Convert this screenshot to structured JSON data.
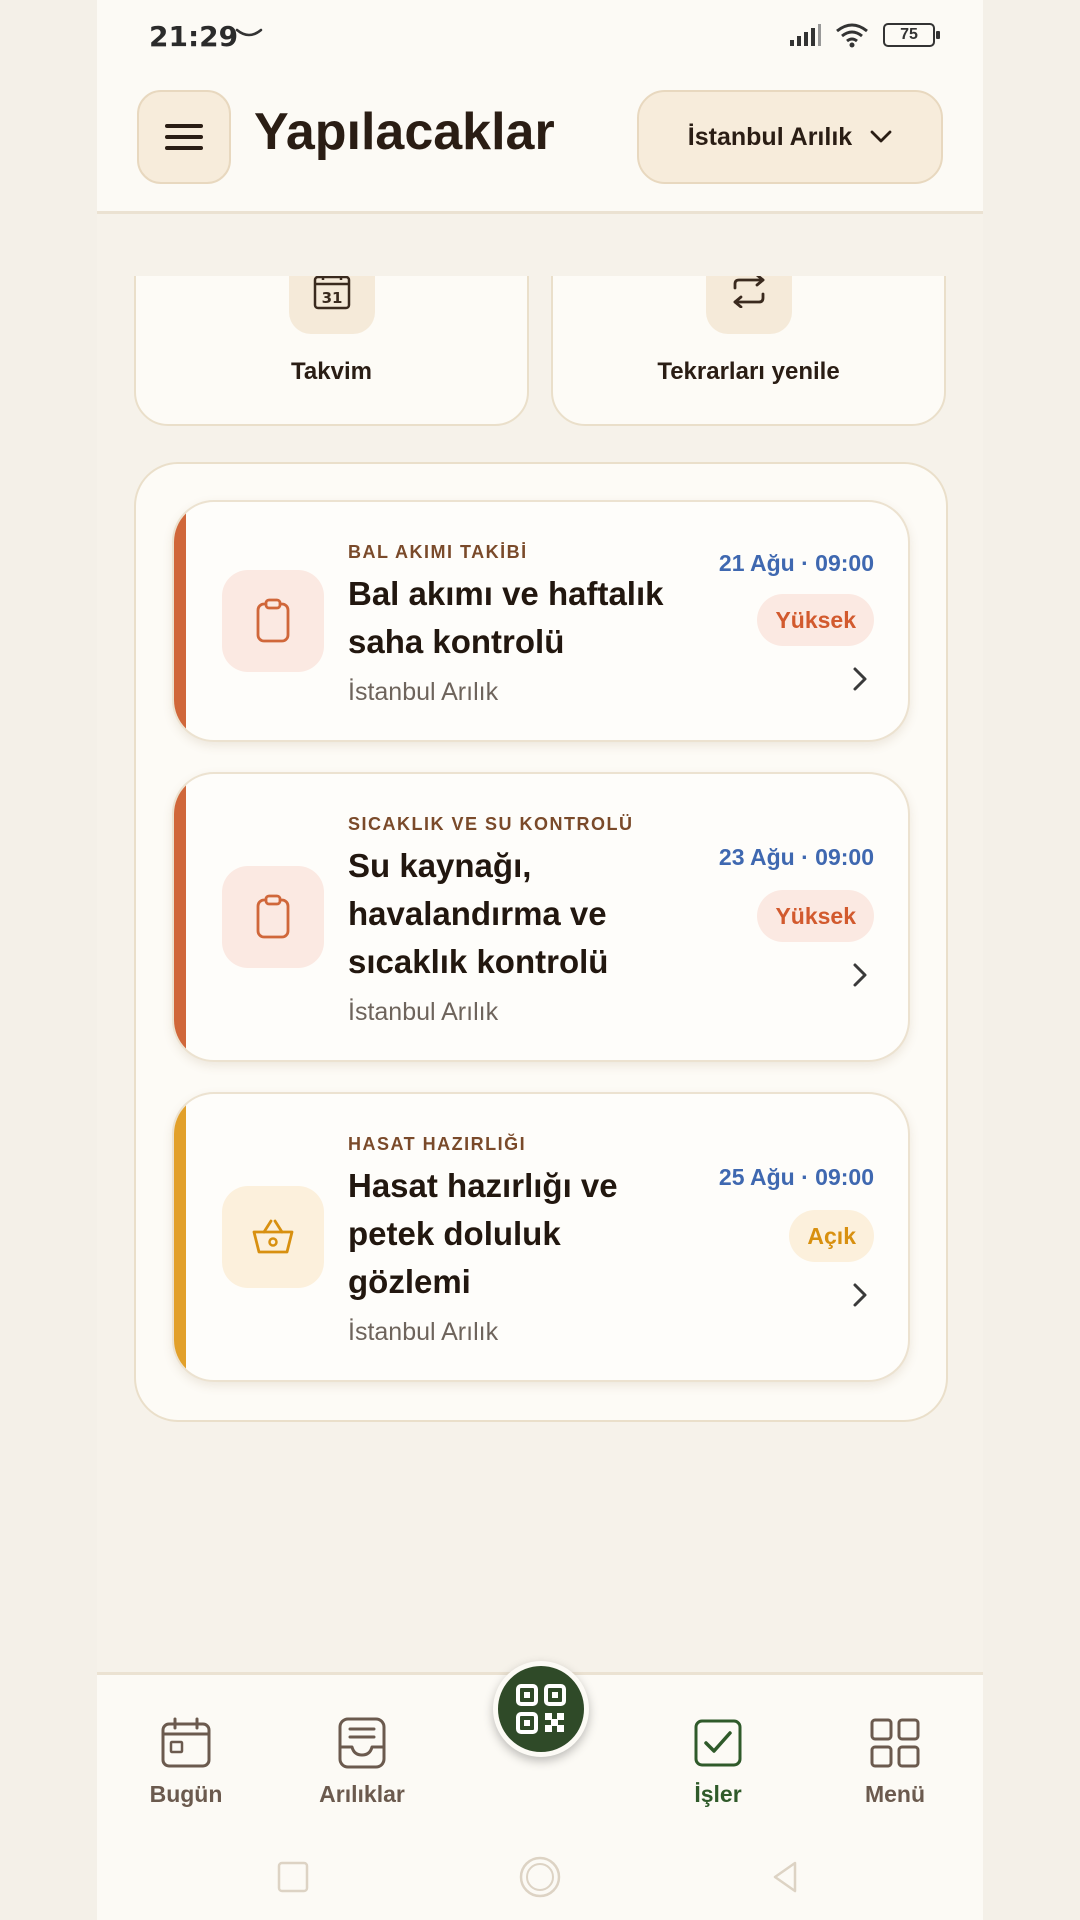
{
  "status_bar": {
    "time": "21:29",
    "battery": "75"
  },
  "header": {
    "title": "Yapılacaklar",
    "apiary_selector": "İstanbul Arılık"
  },
  "quick_actions": [
    {
      "label": "Takvim",
      "icon": "calendar-icon",
      "day": "31"
    },
    {
      "label": "Tekrarları yenile",
      "icon": "repeat-icon"
    }
  ],
  "tasks": [
    {
      "category": "BAL AKIMI TAKİBİ",
      "title": "Bal akımı ve haftalık saha kontrolü",
      "location": "İstanbul Arılık",
      "date": "21 Ağu · 09:00",
      "priority": "Yüksek",
      "accent": "#d0673a",
      "icon": "clipboard-icon"
    },
    {
      "category": "SICAKLIK VE SU KONTROLÜ",
      "title": "Su kaynağı, havalandırma ve sıcaklık kontrolü",
      "location": "İstanbul Arılık",
      "date": "23 Ağu · 09:00",
      "priority": "Yüksek",
      "accent": "#d0673a",
      "icon": "clipboard-icon"
    },
    {
      "category": "HASAT HAZIRLIĞI",
      "title": "Hasat hazırlığı ve petek doluluk gözlemi",
      "location": "İstanbul Arılık",
      "date": "25 Ağu · 09:00",
      "priority": "Açık",
      "accent": "#e2a02a",
      "icon": "basket-icon"
    }
  ],
  "bottom_nav": {
    "items": [
      {
        "label": "Bugün",
        "icon": "calendar-today-icon"
      },
      {
        "label": "Arılıklar",
        "icon": "inbox-icon"
      },
      {
        "label": "İşler",
        "icon": "checkbox-icon",
        "active": true
      },
      {
        "label": "Menü",
        "icon": "grid-icon"
      }
    ],
    "fab_icon": "qr-code-icon"
  },
  "colors": {
    "accent_high": "#d0673a",
    "accent_open": "#e2a02a",
    "date_blue": "#3f68b0",
    "nav_active": "#2f5a2a",
    "fab": "#2f4a28"
  }
}
